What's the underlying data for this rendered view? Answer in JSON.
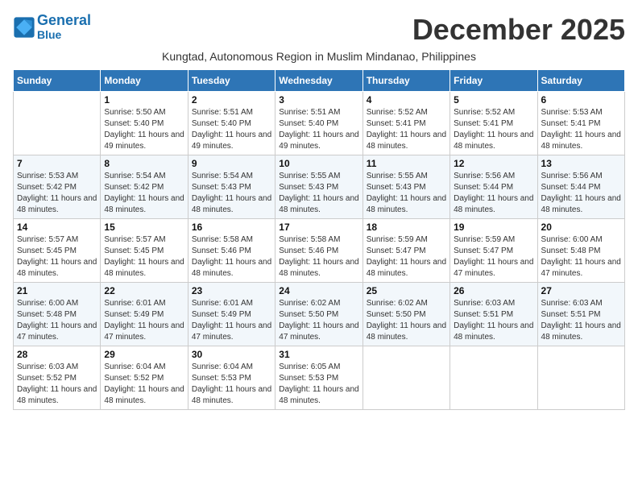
{
  "brand": {
    "name_line1": "General",
    "name_line2": "Blue"
  },
  "header": {
    "title": "December 2025",
    "subtitle": "Kungtad, Autonomous Region in Muslim Mindanao, Philippines"
  },
  "columns": [
    "Sunday",
    "Monday",
    "Tuesday",
    "Wednesday",
    "Thursday",
    "Friday",
    "Saturday"
  ],
  "weeks": [
    [
      {
        "day": "",
        "sunrise": "",
        "sunset": "",
        "daylight": ""
      },
      {
        "day": "1",
        "sunrise": "Sunrise: 5:50 AM",
        "sunset": "Sunset: 5:40 PM",
        "daylight": "Daylight: 11 hours and 49 minutes."
      },
      {
        "day": "2",
        "sunrise": "Sunrise: 5:51 AM",
        "sunset": "Sunset: 5:40 PM",
        "daylight": "Daylight: 11 hours and 49 minutes."
      },
      {
        "day": "3",
        "sunrise": "Sunrise: 5:51 AM",
        "sunset": "Sunset: 5:40 PM",
        "daylight": "Daylight: 11 hours and 49 minutes."
      },
      {
        "day": "4",
        "sunrise": "Sunrise: 5:52 AM",
        "sunset": "Sunset: 5:41 PM",
        "daylight": "Daylight: 11 hours and 48 minutes."
      },
      {
        "day": "5",
        "sunrise": "Sunrise: 5:52 AM",
        "sunset": "Sunset: 5:41 PM",
        "daylight": "Daylight: 11 hours and 48 minutes."
      },
      {
        "day": "6",
        "sunrise": "Sunrise: 5:53 AM",
        "sunset": "Sunset: 5:41 PM",
        "daylight": "Daylight: 11 hours and 48 minutes."
      }
    ],
    [
      {
        "day": "7",
        "sunrise": "Sunrise: 5:53 AM",
        "sunset": "Sunset: 5:42 PM",
        "daylight": "Daylight: 11 hours and 48 minutes."
      },
      {
        "day": "8",
        "sunrise": "Sunrise: 5:54 AM",
        "sunset": "Sunset: 5:42 PM",
        "daylight": "Daylight: 11 hours and 48 minutes."
      },
      {
        "day": "9",
        "sunrise": "Sunrise: 5:54 AM",
        "sunset": "Sunset: 5:43 PM",
        "daylight": "Daylight: 11 hours and 48 minutes."
      },
      {
        "day": "10",
        "sunrise": "Sunrise: 5:55 AM",
        "sunset": "Sunset: 5:43 PM",
        "daylight": "Daylight: 11 hours and 48 minutes."
      },
      {
        "day": "11",
        "sunrise": "Sunrise: 5:55 AM",
        "sunset": "Sunset: 5:43 PM",
        "daylight": "Daylight: 11 hours and 48 minutes."
      },
      {
        "day": "12",
        "sunrise": "Sunrise: 5:56 AM",
        "sunset": "Sunset: 5:44 PM",
        "daylight": "Daylight: 11 hours and 48 minutes."
      },
      {
        "day": "13",
        "sunrise": "Sunrise: 5:56 AM",
        "sunset": "Sunset: 5:44 PM",
        "daylight": "Daylight: 11 hours and 48 minutes."
      }
    ],
    [
      {
        "day": "14",
        "sunrise": "Sunrise: 5:57 AM",
        "sunset": "Sunset: 5:45 PM",
        "daylight": "Daylight: 11 hours and 48 minutes."
      },
      {
        "day": "15",
        "sunrise": "Sunrise: 5:57 AM",
        "sunset": "Sunset: 5:45 PM",
        "daylight": "Daylight: 11 hours and 48 minutes."
      },
      {
        "day": "16",
        "sunrise": "Sunrise: 5:58 AM",
        "sunset": "Sunset: 5:46 PM",
        "daylight": "Daylight: 11 hours and 48 minutes."
      },
      {
        "day": "17",
        "sunrise": "Sunrise: 5:58 AM",
        "sunset": "Sunset: 5:46 PM",
        "daylight": "Daylight: 11 hours and 48 minutes."
      },
      {
        "day": "18",
        "sunrise": "Sunrise: 5:59 AM",
        "sunset": "Sunset: 5:47 PM",
        "daylight": "Daylight: 11 hours and 48 minutes."
      },
      {
        "day": "19",
        "sunrise": "Sunrise: 5:59 AM",
        "sunset": "Sunset: 5:47 PM",
        "daylight": "Daylight: 11 hours and 47 minutes."
      },
      {
        "day": "20",
        "sunrise": "Sunrise: 6:00 AM",
        "sunset": "Sunset: 5:48 PM",
        "daylight": "Daylight: 11 hours and 47 minutes."
      }
    ],
    [
      {
        "day": "21",
        "sunrise": "Sunrise: 6:00 AM",
        "sunset": "Sunset: 5:48 PM",
        "daylight": "Daylight: 11 hours and 47 minutes."
      },
      {
        "day": "22",
        "sunrise": "Sunrise: 6:01 AM",
        "sunset": "Sunset: 5:49 PM",
        "daylight": "Daylight: 11 hours and 47 minutes."
      },
      {
        "day": "23",
        "sunrise": "Sunrise: 6:01 AM",
        "sunset": "Sunset: 5:49 PM",
        "daylight": "Daylight: 11 hours and 47 minutes."
      },
      {
        "day": "24",
        "sunrise": "Sunrise: 6:02 AM",
        "sunset": "Sunset: 5:50 PM",
        "daylight": "Daylight: 11 hours and 47 minutes."
      },
      {
        "day": "25",
        "sunrise": "Sunrise: 6:02 AM",
        "sunset": "Sunset: 5:50 PM",
        "daylight": "Daylight: 11 hours and 48 minutes."
      },
      {
        "day": "26",
        "sunrise": "Sunrise: 6:03 AM",
        "sunset": "Sunset: 5:51 PM",
        "daylight": "Daylight: 11 hours and 48 minutes."
      },
      {
        "day": "27",
        "sunrise": "Sunrise: 6:03 AM",
        "sunset": "Sunset: 5:51 PM",
        "daylight": "Daylight: 11 hours and 48 minutes."
      }
    ],
    [
      {
        "day": "28",
        "sunrise": "Sunrise: 6:03 AM",
        "sunset": "Sunset: 5:52 PM",
        "daylight": "Daylight: 11 hours and 48 minutes."
      },
      {
        "day": "29",
        "sunrise": "Sunrise: 6:04 AM",
        "sunset": "Sunset: 5:52 PM",
        "daylight": "Daylight: 11 hours and 48 minutes."
      },
      {
        "day": "30",
        "sunrise": "Sunrise: 6:04 AM",
        "sunset": "Sunset: 5:53 PM",
        "daylight": "Daylight: 11 hours and 48 minutes."
      },
      {
        "day": "31",
        "sunrise": "Sunrise: 6:05 AM",
        "sunset": "Sunset: 5:53 PM",
        "daylight": "Daylight: 11 hours and 48 minutes."
      },
      {
        "day": "",
        "sunrise": "",
        "sunset": "",
        "daylight": ""
      },
      {
        "day": "",
        "sunrise": "",
        "sunset": "",
        "daylight": ""
      },
      {
        "day": "",
        "sunrise": "",
        "sunset": "",
        "daylight": ""
      }
    ]
  ]
}
